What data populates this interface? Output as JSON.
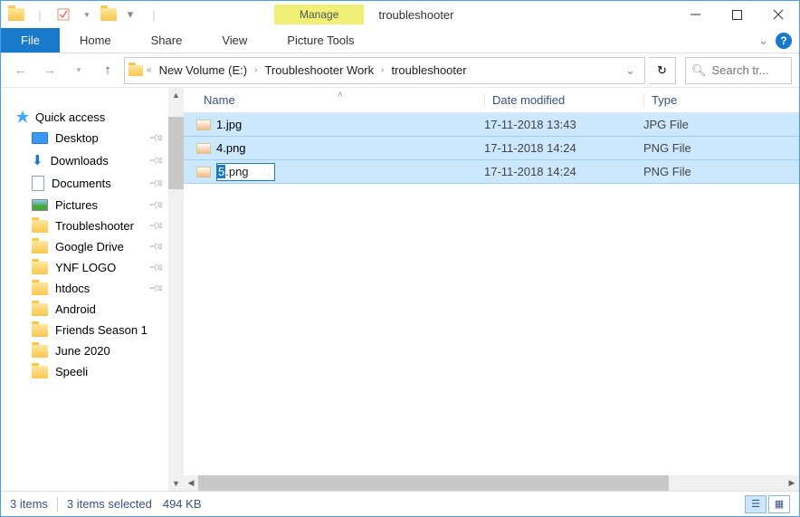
{
  "title": "troubleshooter",
  "context_tab": "Manage",
  "context_tool": "Picture Tools",
  "ribbon": {
    "file": "File",
    "tabs": [
      "Home",
      "Share",
      "View"
    ]
  },
  "breadcrumbs": [
    "New Volume (E:)",
    "Troubleshooter Work",
    "troubleshooter"
  ],
  "search": {
    "placeholder": "Search tr..."
  },
  "sidebar": {
    "quick_access": "Quick access",
    "items": [
      {
        "label": "Desktop",
        "icon": "desktop",
        "pinned": true
      },
      {
        "label": "Downloads",
        "icon": "downloads",
        "pinned": true
      },
      {
        "label": "Documents",
        "icon": "documents",
        "pinned": true
      },
      {
        "label": "Pictures",
        "icon": "pictures",
        "pinned": true
      },
      {
        "label": "Troubleshooter",
        "icon": "folder",
        "pinned": true
      },
      {
        "label": "Google Drive",
        "icon": "folder",
        "pinned": true
      },
      {
        "label": "YNF LOGO",
        "icon": "folder",
        "pinned": true
      },
      {
        "label": "htdocs",
        "icon": "folder",
        "pinned": true
      },
      {
        "label": "Android",
        "icon": "folder",
        "pinned": false
      },
      {
        "label": "Friends Season 1",
        "icon": "folder",
        "pinned": false
      },
      {
        "label": "June 2020",
        "icon": "folder",
        "pinned": false
      },
      {
        "label": "Speeli",
        "icon": "folder",
        "pinned": false
      }
    ]
  },
  "columns": {
    "name": "Name",
    "date": "Date modified",
    "type": "Type"
  },
  "files": [
    {
      "name": "1.jpg",
      "date": "17-11-2018 13:43",
      "type": "JPG File",
      "renaming": false
    },
    {
      "name": "4.png",
      "date": "17-11-2018 14:24",
      "type": "PNG File",
      "renaming": false
    },
    {
      "name": "5.png",
      "date": "17-11-2018 14:24",
      "type": "PNG File",
      "renaming": true,
      "sel": "5",
      "rest": ".png"
    }
  ],
  "status": {
    "count": "3 items",
    "selected": "3 items selected",
    "size": "494 KB"
  }
}
